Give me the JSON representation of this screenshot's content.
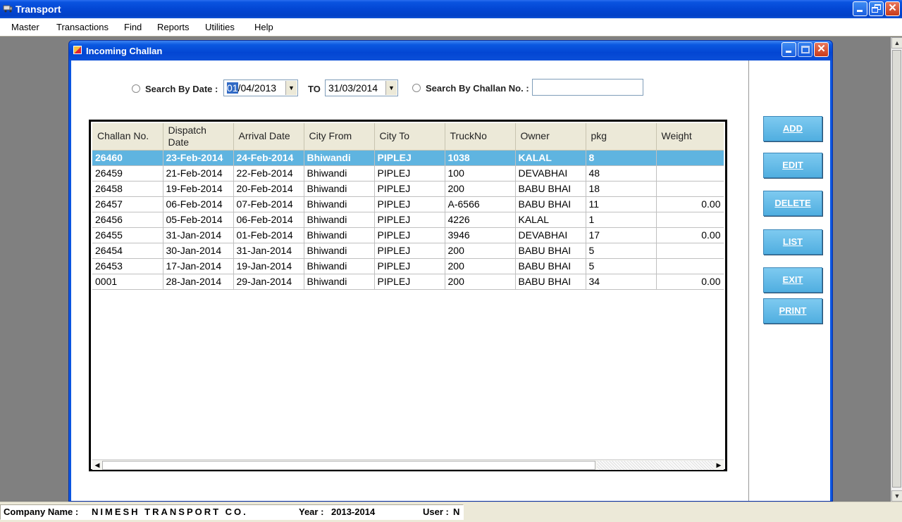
{
  "app": {
    "title": "Transport"
  },
  "menu": [
    "Master",
    "Transactions",
    "Find",
    "Reports",
    "Utilities",
    "Help"
  ],
  "window": {
    "title": "Incoming Challan"
  },
  "search": {
    "by_date_label": "Search By Date :",
    "from_date_sel": "01",
    "from_date_rest": "/04/2013",
    "to_label": "TO",
    "to_date": "31/03/2014",
    "by_challan_label": "Search By Challan No. :",
    "challan_value": ""
  },
  "grid": {
    "columns": [
      "Challan No.",
      "Dispatch Date",
      "Arrival Date",
      "City From",
      "City To",
      "TruckNo",
      "Owner",
      "pkg",
      "Weight"
    ],
    "rows": [
      [
        "26460",
        "23-Feb-2014",
        "24-Feb-2014",
        "Bhiwandi",
        "PIPLEJ",
        "1038",
        "KALAL",
        "8",
        ""
      ],
      [
        "26459",
        "21-Feb-2014",
        "22-Feb-2014",
        "Bhiwandi",
        "PIPLEJ",
        "100",
        "DEVABHAI",
        "48",
        ""
      ],
      [
        "26458",
        "19-Feb-2014",
        "20-Feb-2014",
        "Bhiwandi",
        "PIPLEJ",
        "200",
        "BABU BHAI",
        "18",
        ""
      ],
      [
        "26457",
        "06-Feb-2014",
        "07-Feb-2014",
        "Bhiwandi",
        "PIPLEJ",
        "A-6566",
        "BABU BHAI",
        "11",
        "0.00"
      ],
      [
        "26456",
        "05-Feb-2014",
        "06-Feb-2014",
        "Bhiwandi",
        "PIPLEJ",
        "4226",
        "KALAL",
        "1",
        ""
      ],
      [
        "26455",
        "31-Jan-2014",
        "01-Feb-2014",
        "Bhiwandi",
        "PIPLEJ",
        "3946",
        "DEVABHAI",
        "17",
        "0.00"
      ],
      [
        "26454",
        "30-Jan-2014",
        "31-Jan-2014",
        "Bhiwandi",
        "PIPLEJ",
        "200",
        "BABU BHAI",
        "5",
        ""
      ],
      [
        "26453",
        "17-Jan-2014",
        "19-Jan-2014",
        "Bhiwandi",
        "PIPLEJ",
        "200",
        "BABU BHAI",
        "5",
        ""
      ],
      [
        "0001",
        "28-Jan-2014",
        "29-Jan-2014",
        "Bhiwandi",
        "PIPLEJ",
        "200",
        "BABU BHAI",
        "34",
        "0.00"
      ]
    ],
    "selected_row": 0
  },
  "buttons": {
    "add": "ADD",
    "edit": "EDIT",
    "delete": "DELETE",
    "list": "LIST",
    "exit": "EXIT",
    "print": "PRINT"
  },
  "status": {
    "company_label": "Company Name :",
    "company_value": "NIMESH TRANSPORT CO.",
    "year_label": "Year :",
    "year_value": "2013-2014",
    "user_label": "User :",
    "user_value": "N"
  },
  "colors": {
    "title_blue": "#0346d3",
    "selected_row": "#5fb4e0",
    "button": "#50aee0"
  }
}
